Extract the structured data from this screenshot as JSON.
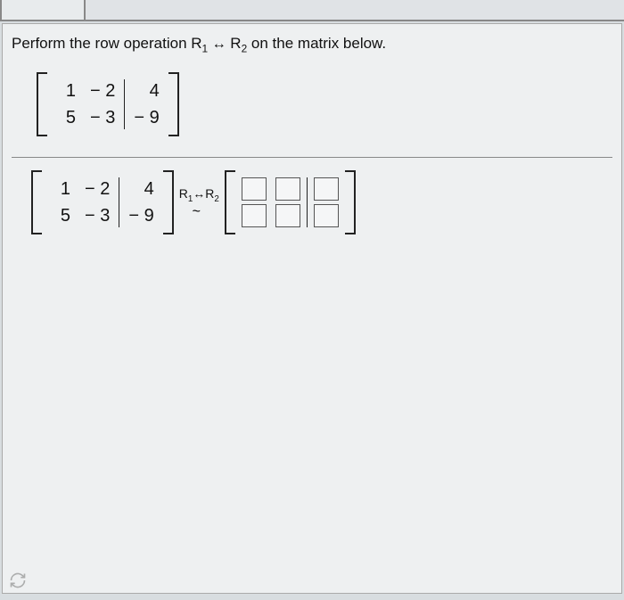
{
  "instruction": {
    "prefix": "Perform the row operation ",
    "op_r1": "R",
    "op_r1_sub": "1",
    "op_arrow": " ↔ ",
    "op_r2": "R",
    "op_r2_sub": "2",
    "suffix": " on the matrix below."
  },
  "matrix_given": {
    "col1": [
      "1",
      "5"
    ],
    "col2": [
      "− 2",
      "− 3"
    ],
    "aug": [
      "4",
      "− 9"
    ]
  },
  "equation": {
    "left_matrix": {
      "col1": [
        "1",
        "5"
      ],
      "col2": [
        "− 2",
        "− 3"
      ],
      "aug": [
        "4",
        "− 9"
      ]
    },
    "op_label_r1": "R",
    "op_label_r1_sub": "1",
    "op_label_arrow": "↔",
    "op_label_r2": "R",
    "op_label_r2_sub": "2",
    "tilde": "~"
  },
  "chart_data": {
    "type": "table",
    "description": "Augmented matrix and row-swap operation",
    "given_matrix": [
      [
        1,
        -2,
        4
      ],
      [
        5,
        -3,
        -9
      ]
    ],
    "augment_split": 2,
    "operation": "R1 <-> R2",
    "answer_blank_shape": [
      2,
      3
    ]
  }
}
